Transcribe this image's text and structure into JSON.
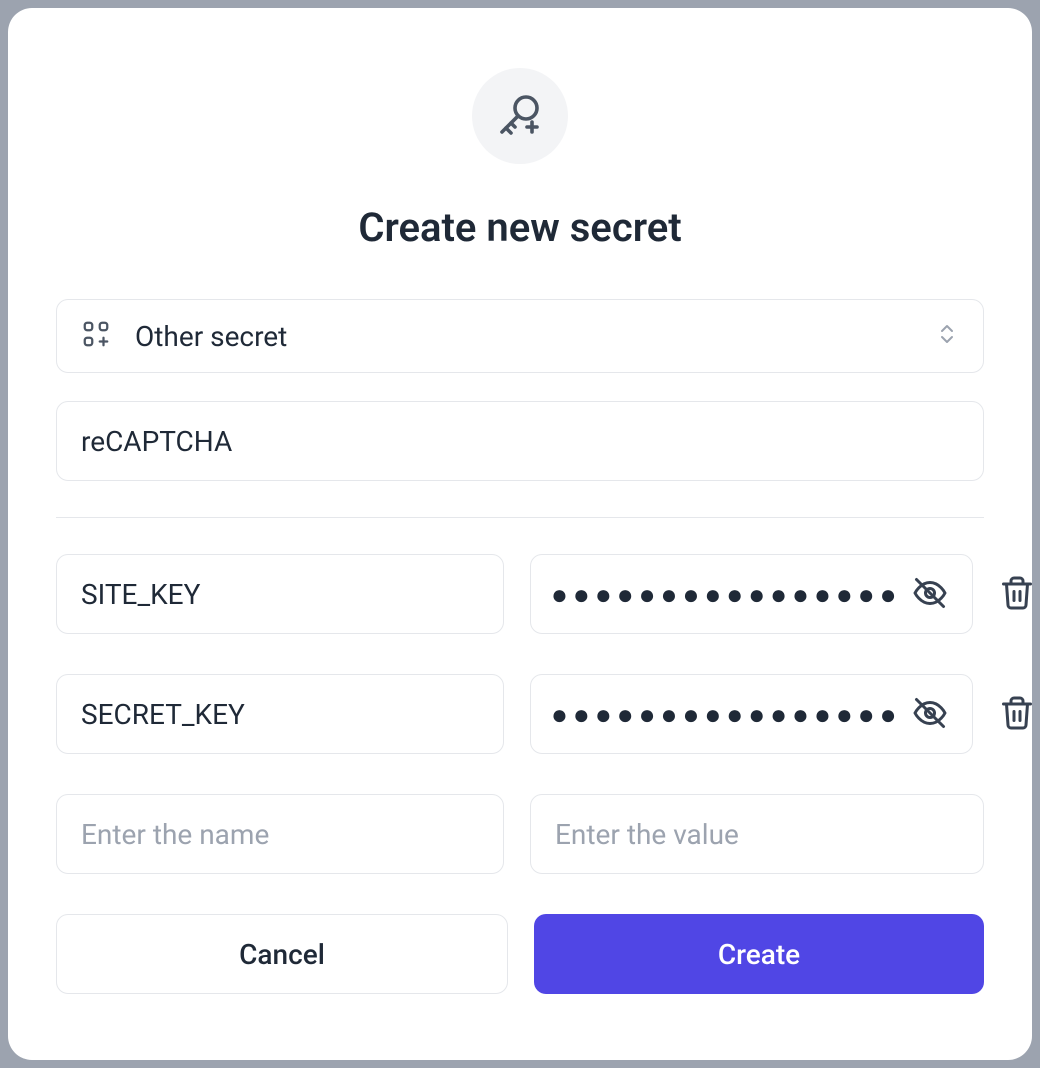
{
  "title": "Create new secret",
  "type_select": {
    "label": "Other secret"
  },
  "secret_name": "reCAPTCHA",
  "rows": [
    {
      "name": "SITE_KEY",
      "masked_value": "●●●●●●●●●●●●●●●●"
    },
    {
      "name": "SECRET_KEY",
      "masked_value": "●●●●●●●●●●●●●●●●"
    }
  ],
  "new_row": {
    "name_placeholder": "Enter the name",
    "value_placeholder": "Enter the value"
  },
  "buttons": {
    "cancel": "Cancel",
    "create": "Create"
  }
}
